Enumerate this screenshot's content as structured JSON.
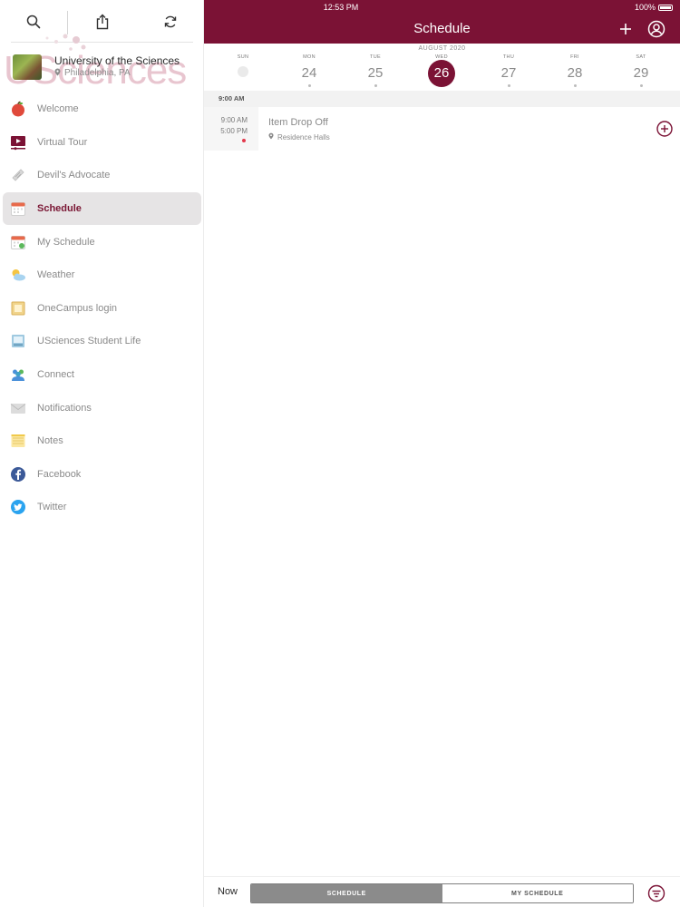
{
  "status_bar": {
    "time": "12:53 PM",
    "battery": "100%"
  },
  "sidebar": {
    "watermark": "USciences",
    "org": {
      "name": "University of the Sciences",
      "location": "Philadelphia, PA"
    },
    "items": [
      {
        "label": "Welcome",
        "icon": "apple-icon"
      },
      {
        "label": "Virtual Tour",
        "icon": "video-icon"
      },
      {
        "label": "Devil's Advocate",
        "icon": "newspaper-icon"
      },
      {
        "label": "Schedule",
        "icon": "calendar-icon",
        "active": true
      },
      {
        "label": "My Schedule",
        "icon": "calendar-check-icon"
      },
      {
        "label": "Weather",
        "icon": "weather-icon"
      },
      {
        "label": "OneCampus login",
        "icon": "portal-icon"
      },
      {
        "label": "USciences Student Life",
        "icon": "laptop-icon"
      },
      {
        "label": "Connect",
        "icon": "people-icon"
      },
      {
        "label": "Notifications",
        "icon": "envelope-icon"
      },
      {
        "label": "Notes",
        "icon": "notes-icon"
      },
      {
        "label": "Facebook",
        "icon": "facebook-icon"
      },
      {
        "label": "Twitter",
        "icon": "twitter-icon"
      }
    ]
  },
  "header": {
    "title": "Schedule"
  },
  "week": {
    "month": "AUGUST 2020",
    "days": [
      {
        "dow": "SUN",
        "num": ""
      },
      {
        "dow": "MON",
        "num": "24"
      },
      {
        "dow": "TUE",
        "num": "25"
      },
      {
        "dow": "WED",
        "num": "26",
        "selected": true
      },
      {
        "dow": "THU",
        "num": "27"
      },
      {
        "dow": "FRI",
        "num": "28"
      },
      {
        "dow": "SAT",
        "num": "29"
      }
    ]
  },
  "schedule": {
    "section_time": "9:00 AM",
    "events": [
      {
        "start": "9:00 AM",
        "end": "5:00 PM",
        "title": "Item Drop Off",
        "location": "Residence Halls"
      }
    ]
  },
  "bottom_bar": {
    "now_label": "Now",
    "segments": [
      "SCHEDULE",
      "MY SCHEDULE"
    ],
    "selected_segment": 0
  },
  "colors": {
    "brand": "#7b1235",
    "event_dot": "#e3394c"
  }
}
